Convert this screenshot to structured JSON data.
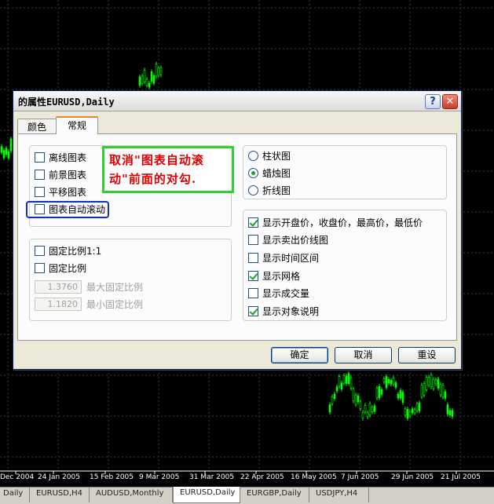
{
  "dates": [
    "Dec 2004",
    "24 Jan 2005",
    "15 Feb 2005",
    "9 Mar 2005",
    "31 Mar 2005",
    "22 Apr 2005",
    "16 May 2005",
    "7 Jun 2005",
    "29 Jun 2005",
    "21 Jul 2005"
  ],
  "chart_tabs": [
    "Daily",
    "EURUSD,H4",
    "AUDUSD,Monthly",
    "EURUSD,Daily",
    "EURGBP,Daily",
    "USDJPY,H4"
  ],
  "active_tab_index": 3,
  "colors": {
    "background": "#000000",
    "grid": "#3a3a3a",
    "candles": "#00ff00",
    "callout_text": "#e00000",
    "callout_border": "#2fd12f",
    "highlight": "#1030c0",
    "arrow": "#f08020"
  },
  "dialog": {
    "title": "的属性EURUSD,Daily",
    "help_icon": "?",
    "close_icon": "✕",
    "tabs": [
      "颜色",
      "常规"
    ],
    "left_options": [
      {
        "label": "离线图表",
        "checked": false
      },
      {
        "label": "前景图表",
        "checked": false
      },
      {
        "label": "平移图表",
        "checked": false
      },
      {
        "label": "图表自动滚动",
        "checked": false
      }
    ],
    "scale_options": [
      {
        "label": "固定比例1:1",
        "checked": false
      },
      {
        "label": "固定比例",
        "checked": false
      }
    ],
    "max_scale": {
      "value": "1.3760",
      "label": "最大固定比例"
    },
    "min_scale": {
      "value": "1.1820",
      "label": "最小固定比例"
    },
    "chart_types": [
      {
        "label": "柱状图",
        "checked": false
      },
      {
        "label": "蜡烛图",
        "checked": true
      },
      {
        "label": "折线图",
        "checked": false
      }
    ],
    "display_options": [
      {
        "label": "显示开盘价，收盘价，最高价，最低价",
        "checked": true
      },
      {
        "label": "显示卖出价线图",
        "checked": false
      },
      {
        "label": "显示时间区间",
        "checked": false
      },
      {
        "label": "显示网格",
        "checked": true
      },
      {
        "label": "显示成交量",
        "checked": false
      },
      {
        "label": "显示对象说明",
        "checked": true
      }
    ],
    "buttons": {
      "ok": "确定",
      "cancel": "取消",
      "reset": "重设"
    }
  },
  "callout": {
    "line1": "取消\"图表自动滚",
    "line2": "动\"前面的对勾."
  }
}
